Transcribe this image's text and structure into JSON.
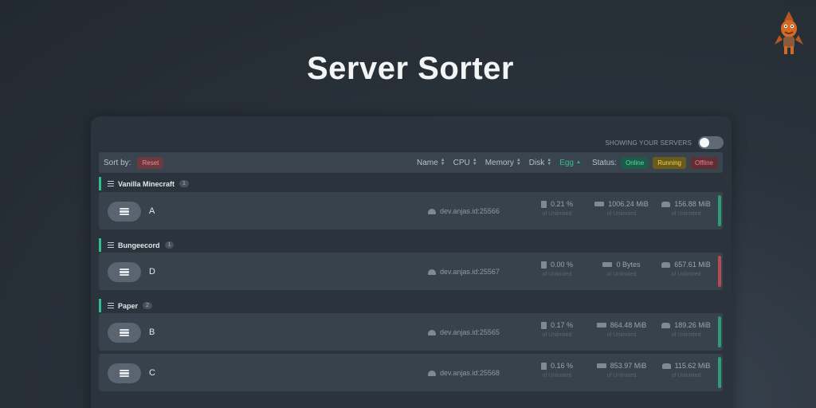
{
  "page": {
    "title": "Server Sorter"
  },
  "toggle": {
    "label": "SHOWING YOUR SERVERS"
  },
  "sortbar": {
    "sort_label": "Sort by:",
    "reset_label": "Reset",
    "sort_fields": [
      "Name",
      "CPU",
      "Memory",
      "Disk",
      "Egg"
    ],
    "active_sort": "Egg",
    "status_label": "Status:",
    "status_filters": [
      "Online",
      "Running",
      "Offline"
    ]
  },
  "colors": {
    "online": "#2e9e78",
    "offline": "#b94a52",
    "accent": "#2fbf8c"
  },
  "groups": [
    {
      "name": "Vanilla Minecraft",
      "count": "1",
      "servers": [
        {
          "name": "A",
          "address": "dev.anjas.id:25566",
          "cpu": "0.21 %",
          "memory": "1006.24 MiB",
          "disk": "156.88 MiB",
          "limit": "of Unlimited",
          "status": "online"
        }
      ]
    },
    {
      "name": "Bungeecord",
      "count": "1",
      "servers": [
        {
          "name": "D",
          "address": "dev.anjas.id:25567",
          "cpu": "0.00 %",
          "memory": "0 Bytes",
          "disk": "657.61 MiB",
          "limit": "of Unlimited",
          "status": "offline"
        }
      ]
    },
    {
      "name": "Paper",
      "count": "2",
      "servers": [
        {
          "name": "B",
          "address": "dev.anjas.id:25565",
          "cpu": "0.17 %",
          "memory": "864.48 MiB",
          "disk": "189.26 MiB",
          "limit": "of Unlimited",
          "status": "online"
        },
        {
          "name": "C",
          "address": "dev.anjas.id:25568",
          "cpu": "0.16 %",
          "memory": "853.97 MiB",
          "disk": "115.62 MiB",
          "limit": "of Unlimited",
          "status": "online"
        }
      ]
    }
  ]
}
